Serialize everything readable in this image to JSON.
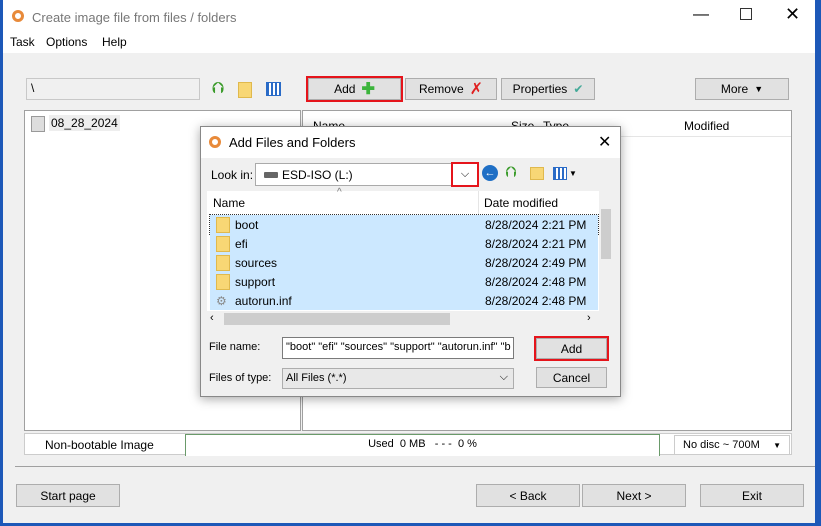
{
  "window": {
    "title": "Create image file from files / folders",
    "menu": [
      "Task",
      "Options",
      "Help"
    ]
  },
  "toolbar": {
    "path": "\\",
    "add": "Add",
    "remove": "Remove",
    "properties": "Properties",
    "more": "More"
  },
  "tree": {
    "items": [
      "08_28_2024"
    ]
  },
  "filelist": {
    "columns": [
      "Name",
      "Size",
      "Type",
      "Modified"
    ]
  },
  "status": {
    "boot": "Non-bootable Image",
    "used": "Used  0 MB   - - -  0 %",
    "used_percent": 0,
    "disc": "No disc ~ 700M"
  },
  "footer": {
    "start": "Start page",
    "back": "< Back",
    "next": "Next >",
    "exit": "Exit"
  },
  "dialog": {
    "title": "Add Files and Folders",
    "look_in_label": "Look in:",
    "look_in": "ESD-ISO (L:)",
    "columns": [
      "Name",
      "Date modified"
    ],
    "rows": [
      {
        "name": "boot",
        "date": "8/28/2024 2:21 PM",
        "type": "folder"
      },
      {
        "name": "efi",
        "date": "8/28/2024 2:21 PM",
        "type": "folder"
      },
      {
        "name": "sources",
        "date": "8/28/2024 2:49 PM",
        "type": "folder"
      },
      {
        "name": "support",
        "date": "8/28/2024 2:48 PM",
        "type": "folder"
      },
      {
        "name": "autorun.inf",
        "date": "8/28/2024 2:48 PM",
        "type": "file"
      }
    ],
    "file_name_label": "File name:",
    "file_name": "\"boot\" \"efi\" \"sources\" \"support\" \"autorun.inf\" \"b",
    "file_type_label": "Files of type:",
    "file_type": "All Files (*.*)",
    "add": "Add",
    "cancel": "Cancel"
  },
  "colors": {
    "highlight": "#e5141b",
    "selection": "#cce8ff"
  }
}
